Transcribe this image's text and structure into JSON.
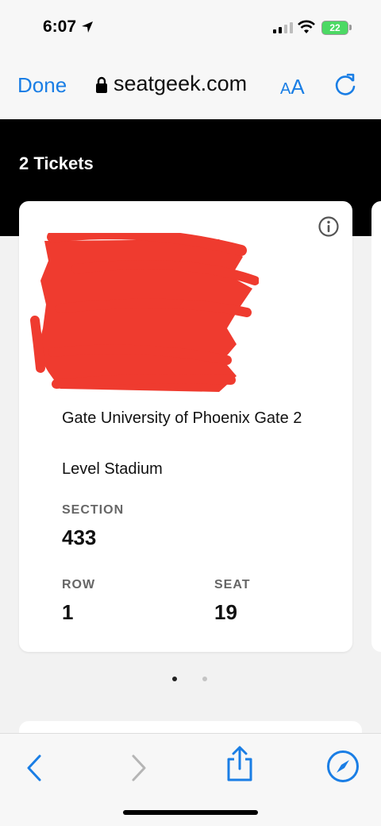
{
  "status_bar": {
    "time": "6:07",
    "battery_level": "22"
  },
  "browser": {
    "done_label": "Done",
    "url": "seatgeek.com",
    "text_size_label_small": "A",
    "text_size_label_big": "A",
    "accent_color": "#1a7ee5"
  },
  "page": {
    "title": "2 Tickets"
  },
  "ticket": {
    "gate": "Gate University of Phoenix Gate 2",
    "level": "Level Stadium",
    "section_label": "SECTION",
    "section_value": "433",
    "row_label": "ROW",
    "row_value": "1",
    "seat_label": "SEAT",
    "seat_value": "19"
  },
  "pager": {
    "current": 1,
    "total": 2
  },
  "icons": {
    "location": "location-arrow-icon",
    "lock": "lock-icon",
    "reload": "reload-icon",
    "info": "info-icon",
    "back": "chevron-left-icon",
    "forward": "chevron-right-icon",
    "share": "share-icon",
    "compass": "compass-icon"
  }
}
